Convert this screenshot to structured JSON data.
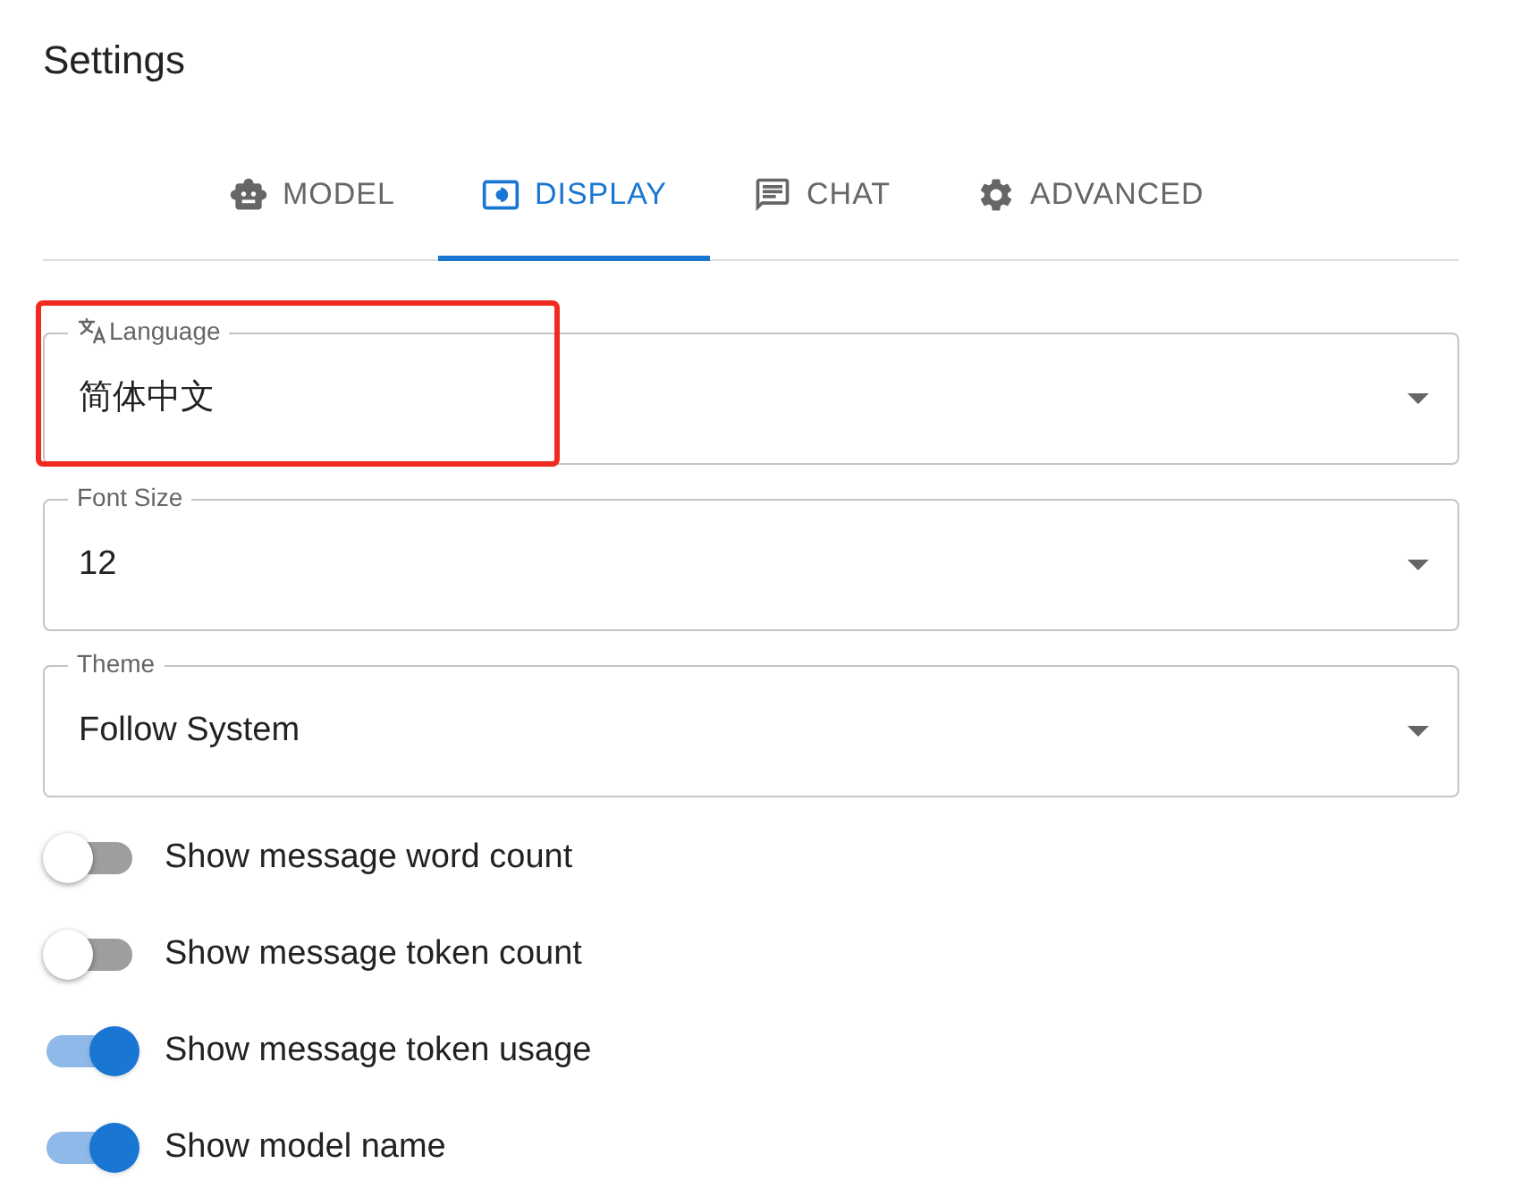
{
  "title": "Settings",
  "tabs": [
    {
      "label": "MODEL",
      "selected": false
    },
    {
      "label": "DISPLAY",
      "selected": true
    },
    {
      "label": "CHAT",
      "selected": false
    },
    {
      "label": "ADVANCED",
      "selected": false
    }
  ],
  "fields": [
    {
      "label": "Language",
      "value": "简体中文",
      "highlighted": true
    },
    {
      "label": "Font Size",
      "value": "12",
      "highlighted": false
    },
    {
      "label": "Theme",
      "value": "Follow System",
      "highlighted": false
    }
  ],
  "toggles": [
    {
      "label": "Show message word count",
      "on": false
    },
    {
      "label": "Show message token count",
      "on": false
    },
    {
      "label": "Show message token usage",
      "on": true
    },
    {
      "label": "Show model name",
      "on": true
    }
  ]
}
